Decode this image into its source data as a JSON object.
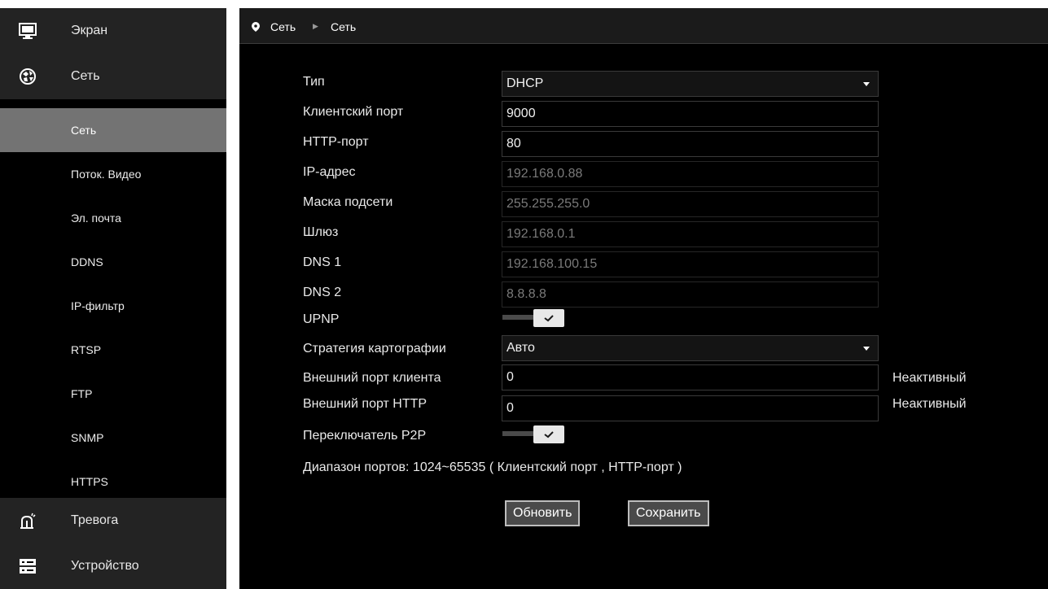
{
  "sidebar": {
    "categories": [
      {
        "label": "Экран",
        "icon": "monitor-icon"
      },
      {
        "label": "Сеть",
        "icon": "network-icon"
      },
      {
        "label": "Тревога",
        "icon": "alarm-icon"
      },
      {
        "label": "Устройство",
        "icon": "device-icon"
      }
    ],
    "items": [
      {
        "label": "Сеть",
        "active": true
      },
      {
        "label": "Поток. Видео"
      },
      {
        "label": "Эл. почта"
      },
      {
        "label": "DDNS"
      },
      {
        "label": "IP-фильтр"
      },
      {
        "label": "RTSP"
      },
      {
        "label": "FTP"
      },
      {
        "label": "SNMP"
      },
      {
        "label": "HTTPS"
      }
    ]
  },
  "breadcrumb": {
    "parent": "Сеть",
    "current": "Сеть"
  },
  "form": {
    "type": {
      "label": "Тип",
      "value": "DHCP"
    },
    "client_port": {
      "label": "Клиентский порт",
      "value": "9000"
    },
    "http_port": {
      "label": "HTTP-порт",
      "value": "80"
    },
    "ip": {
      "label": "IP-адрес",
      "value": "192.168.0.88"
    },
    "mask": {
      "label": "Маска подсети",
      "value": "255.255.255.0"
    },
    "gateway": {
      "label": "Шлюз",
      "value": "192.168.0.1"
    },
    "dns1": {
      "label": "DNS 1",
      "value": "192.168.100.15"
    },
    "dns2": {
      "label": "DNS 2",
      "value": "8.8.8.8"
    },
    "upnp": {
      "label": "UPNP",
      "checked": true
    },
    "mapping": {
      "label": "Стратегия картографии",
      "value": "Авто"
    },
    "ext_client_port": {
      "label": "Внешний порт клиента",
      "value": "0",
      "status": "Неактивный"
    },
    "ext_http_port": {
      "label": "Внешний порт HTTP",
      "value": "0",
      "status": "Неактивный"
    },
    "p2p": {
      "label": "Переключатель P2P",
      "checked": true
    }
  },
  "note": "Диапазон портов: 1024~65535 ( Клиентский порт , HTTP-порт )",
  "buttons": {
    "refresh": "Обновить",
    "save": "Сохранить"
  },
  "colors": {
    "background": "#000000",
    "sidebar_category": "#232323",
    "active_item": "#737373",
    "field_border": "#3a3a3a"
  }
}
